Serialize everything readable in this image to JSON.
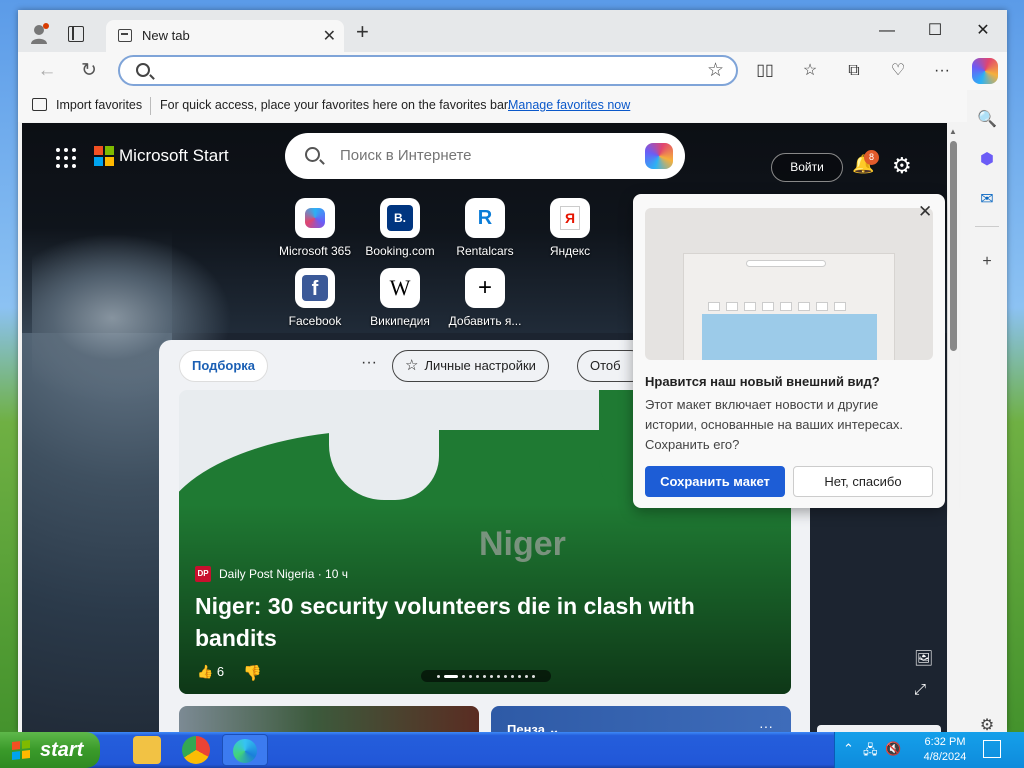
{
  "browser": {
    "tab_title": "New tab",
    "address_placeholder": "",
    "favorites_bar": {
      "import_label": "Import favorites",
      "hint": "For quick access, place your favorites here on the favorites bar.",
      "manage_link": "Manage favorites now"
    }
  },
  "start_page": {
    "brand": "Microsoft Start",
    "search_placeholder": "Поиск в Интернете",
    "login_label": "Войти",
    "notifications_count": "8",
    "quick_links": [
      {
        "label": "Microsoft 365",
        "icon": "microsoft-365-icon"
      },
      {
        "label": "Booking.com",
        "icon": "booking-icon",
        "glyph": "B."
      },
      {
        "label": "Rentalcars",
        "icon": "rentalcars-icon",
        "glyph": "R"
      },
      {
        "label": "Яндекс",
        "icon": "yandex-icon",
        "glyph": "Я"
      },
      {
        "label": "Facebook",
        "icon": "facebook-icon",
        "glyph": "f"
      },
      {
        "label": "Википедия",
        "icon": "wikipedia-icon",
        "glyph": "W"
      },
      {
        "label": "Добавить я...",
        "icon": "add-icon",
        "glyph": "+"
      }
    ],
    "feed": {
      "active_tab": "Подборка",
      "more": "···",
      "personalize": "Личные настройки",
      "cut_pill": "Отоб",
      "hero": {
        "source_badge": "DP",
        "source": "Daily Post Nigeria · 10 ч",
        "watermark": "Niger",
        "title": "Niger: 30 security volunteers die in clash with bandits",
        "likes": "6"
      },
      "city_card": "Пенза"
    }
  },
  "popup": {
    "title": "Нравится наш новый внешний вид?",
    "body": "Этот макет включает новости и другие истории, основанные на ваших интересах. Сохранить его?",
    "save_label": "Сохранить макет",
    "decline_label": "Нет, спасибо"
  },
  "taskbar": {
    "start_label": "start",
    "time": "6:32 PM",
    "date": "4/8/2024"
  },
  "colors": {
    "accent": "#1d5dd6",
    "ms_logo": [
      "#f25022",
      "#7fba00",
      "#00a4ef",
      "#ffb900"
    ],
    "taskbar": "#245edc",
    "start_button": "#3a9a2a"
  }
}
